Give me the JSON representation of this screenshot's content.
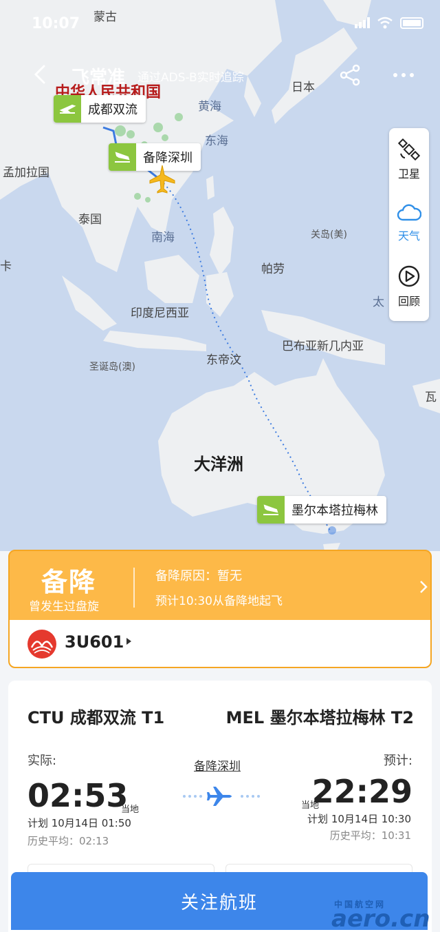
{
  "status_bar": {
    "time": "10:07"
  },
  "header": {
    "back_icon": "chevron-left-icon",
    "title": "飞常准",
    "subtitle": "通过ADS-B实时追踪",
    "share_icon": "share-icon",
    "more_icon": "more-dots-icon"
  },
  "map": {
    "places": {
      "mongolia": "蒙古",
      "prc": "中华人民共和国",
      "japan": "日本",
      "yellow_sea": "黄海",
      "east_sea": "东海",
      "bangladesh": "孟加拉国",
      "thailand": "泰国",
      "south_sea": "南海",
      "guam": "关岛(美)",
      "palau": "帕劳",
      "indonesia": "印度尼西亚",
      "papua": "巴布亚新几内亚",
      "east_timor": "东帝汶",
      "christmas": "圣诞岛(澳)",
      "oceania": "大洋洲",
      "pacific_partial": "太",
      "vanuatu_partial": "瓦",
      "left_partial": "卡"
    },
    "airports": {
      "origin": "成都双流",
      "diverted": "备降深圳",
      "destination": "墨尔本塔拉梅林"
    },
    "panel": {
      "satellite_label": "卫星",
      "weather_label": "天气",
      "replay_label": "回顾"
    },
    "colors": {
      "route_blue": "#3c7be0",
      "airport_green": "#8cc63f",
      "plane_yellow": "#f5b81f"
    }
  },
  "status_card": {
    "status": "备降",
    "sub": "曾发生过盘旋",
    "reason": "备降原因：暂无",
    "forecast": "预计10:30从备降地起飞",
    "airline_icon": "sichuan-airlines-logo",
    "flight_no": "3U601",
    "colors": {
      "bg": "#fdb948"
    }
  },
  "flight_card": {
    "dep": {
      "airport": "CTU 成都双流 T1",
      "label": "实际:",
      "time": "02:53",
      "local": "当地",
      "plan": "计划 10月14日 01:50",
      "hist": "历史平均：02:13"
    },
    "arr": {
      "airport": "MEL 墨尔本塔拉梅林 T2",
      "label": "预计:",
      "time": "22:29",
      "local": "当地",
      "plan": "计划 10月14日 10:30",
      "hist": "历史平均：10:31"
    },
    "middle": {
      "diverted": "备降深圳",
      "plane_icon": "airplane-icon"
    }
  },
  "follow_button": {
    "label": "关注航班"
  },
  "watermark": {
    "cn": "中国航空网",
    "en": "aero.cn"
  }
}
